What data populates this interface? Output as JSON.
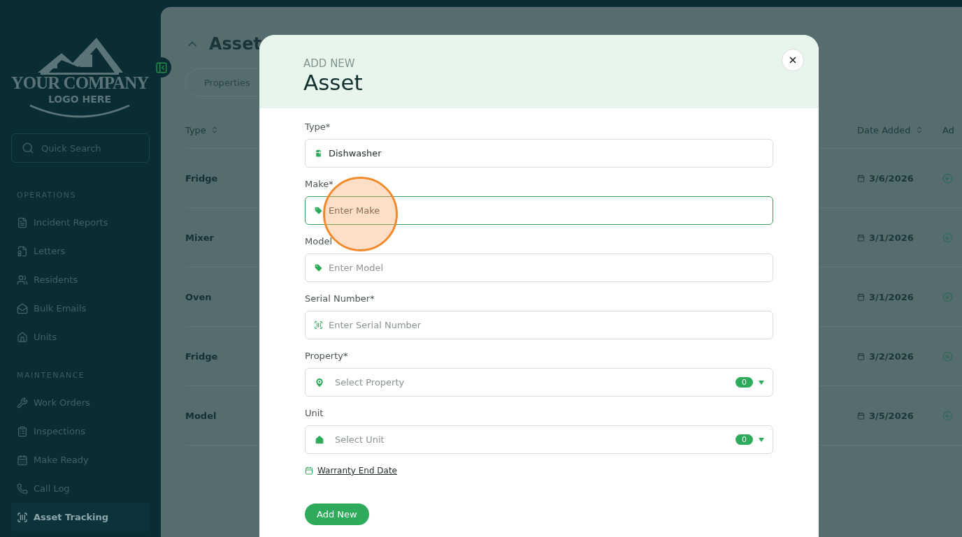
{
  "sidebar": {
    "logo": {
      "line1": "YOUR COMPANY",
      "line2": "LOGO HERE"
    },
    "search": {
      "placeholder": "Quick Search"
    },
    "sections": [
      {
        "title": "OPERATIONS",
        "items": [
          {
            "label": "Incident Reports",
            "selected": false
          },
          {
            "label": "Letters",
            "selected": false
          },
          {
            "label": "Residents",
            "selected": false
          },
          {
            "label": "Bulk Emails",
            "selected": false
          },
          {
            "label": "Units",
            "selected": false
          }
        ]
      },
      {
        "title": "MAINTENANCE",
        "items": [
          {
            "label": "Work Orders",
            "selected": false
          },
          {
            "label": "Inspections",
            "selected": false
          },
          {
            "label": "Make Ready",
            "selected": false
          },
          {
            "label": "Call Log",
            "selected": false
          },
          {
            "label": "Asset Tracking",
            "selected": true
          }
        ]
      }
    ]
  },
  "main": {
    "title": "Asset",
    "filter": "Properties",
    "columns": [
      {
        "label": "Type"
      },
      {
        "label": "Date Added"
      },
      {
        "label": "Ad"
      }
    ],
    "rows": [
      {
        "type": "Fridge",
        "date": "3/6/2026"
      },
      {
        "type": "Mixer",
        "date": "3/1/2026"
      },
      {
        "type": "Oven",
        "date": "3/1/2026"
      },
      {
        "type": "Fridge",
        "date": "3/2/2026"
      },
      {
        "type": "Model",
        "date": "3/5/2026"
      }
    ]
  },
  "modal": {
    "eyebrow": "ADD NEW",
    "title": "Asset",
    "fields": [
      {
        "kind": "input",
        "label": "Type*",
        "value": "Dishwasher",
        "focused": false
      },
      {
        "kind": "input",
        "label": "Make*",
        "placeholder": "Enter Make",
        "focused": true
      },
      {
        "kind": "input",
        "label": "Model",
        "placeholder": "Enter Model",
        "focused": false
      },
      {
        "kind": "input",
        "label": "Serial Number*",
        "placeholder": "Enter Serial Number",
        "focused": false
      },
      {
        "kind": "select",
        "label": "Property*",
        "placeholder": "Select Property",
        "count": "0",
        "focused": false
      },
      {
        "kind": "select",
        "label": "Unit",
        "placeholder": "Select Unit",
        "count": "0",
        "focused": false
      }
    ],
    "link": "Warranty End Date",
    "submit": "Add New"
  }
}
